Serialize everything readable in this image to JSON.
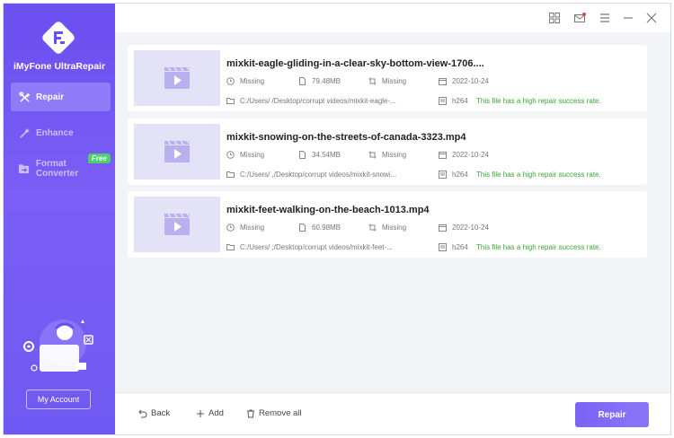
{
  "app": {
    "name": "iMyFone UltraRepair",
    "colors": {
      "accent": "#6b4ff0",
      "success": "#3aa53a"
    }
  },
  "sidebar": {
    "items": [
      {
        "label": "Repair",
        "icon": "tools-icon",
        "active": true
      },
      {
        "label": "Enhance",
        "icon": "magic-wand-icon",
        "active": false
      },
      {
        "label": "Format Converter",
        "icon": "converter-icon",
        "active": false
      }
    ],
    "free_badge": "Free",
    "account_label": "My Account"
  },
  "titlebar": {
    "icons": [
      "grid-icon",
      "mail-icon",
      "menu-icon",
      "minimize-icon",
      "close-icon"
    ]
  },
  "files": [
    {
      "name": "mixkit-eagle-gliding-in-a-clear-sky-bottom-view-1706....",
      "status": "Missing",
      "size": "79.48MB",
      "resolution": "Missing",
      "date": "2022-10-24",
      "path": "C:/Users/        /Desktop/corrupt videos/mixkit-eagle-...",
      "codec": "h264",
      "note": "This file has a high repair success rate."
    },
    {
      "name": "mixkit-snowing-on-the-streets-of-canada-3323.mp4",
      "status": "Missing",
      "size": "34.54MB",
      "resolution": "Missing",
      "date": "2022-10-24",
      "path": "C:/Users/       ,/Desktop/corrupt videos/mixkit-snowi...",
      "codec": "h264",
      "note": "This file has a high repair success rate."
    },
    {
      "name": "mixkit-feet-walking-on-the-beach-1013.mp4",
      "status": "Missing",
      "size": "60.98MB",
      "resolution": "Missing",
      "date": "2022-10-24",
      "path": "C:/Users/        ;/Desktop/corrupt videos/mixkit-feet-...",
      "codec": "h264",
      "note": "This file has a high repair success rate."
    }
  ],
  "footer": {
    "back_label": "Back",
    "add_label": "Add",
    "remove_label": "Remove all",
    "repair_label": "Repair"
  }
}
